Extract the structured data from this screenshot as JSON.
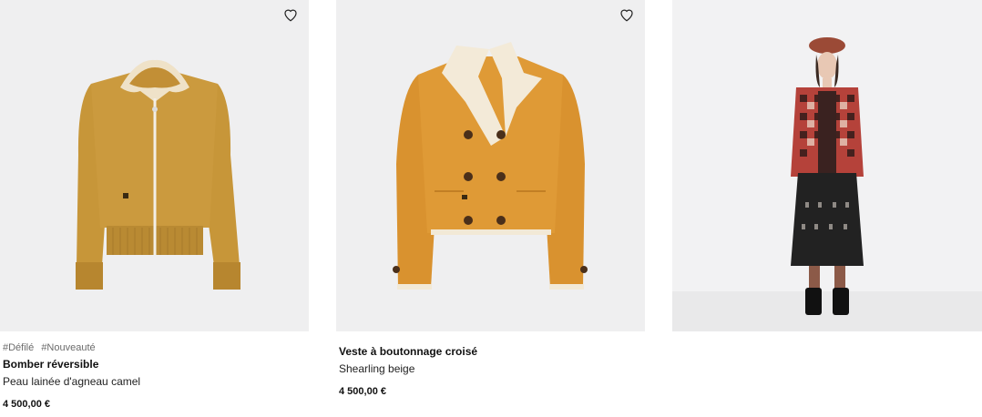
{
  "products": [
    {
      "tags": [
        "#Défilé",
        "#Nouveauté"
      ],
      "name": "Bomber réversible",
      "description": "Peau lainée d'agneau camel",
      "price": "4 500,00 €",
      "icon": "heart-icon",
      "colors": {
        "main": "#c9983c",
        "collar": "#efe3cc"
      }
    },
    {
      "name": "Veste à boutonnage croisé",
      "description": "Shearling beige",
      "price": "4 500,00 €",
      "icon": "heart-icon",
      "colors": {
        "main": "#de9838",
        "collar": "#f3ead8"
      }
    },
    {
      "image_only": true,
      "colors": {
        "jacket": "#b5423a",
        "skirt": "#222222",
        "beret": "#9b4a36"
      }
    }
  ]
}
